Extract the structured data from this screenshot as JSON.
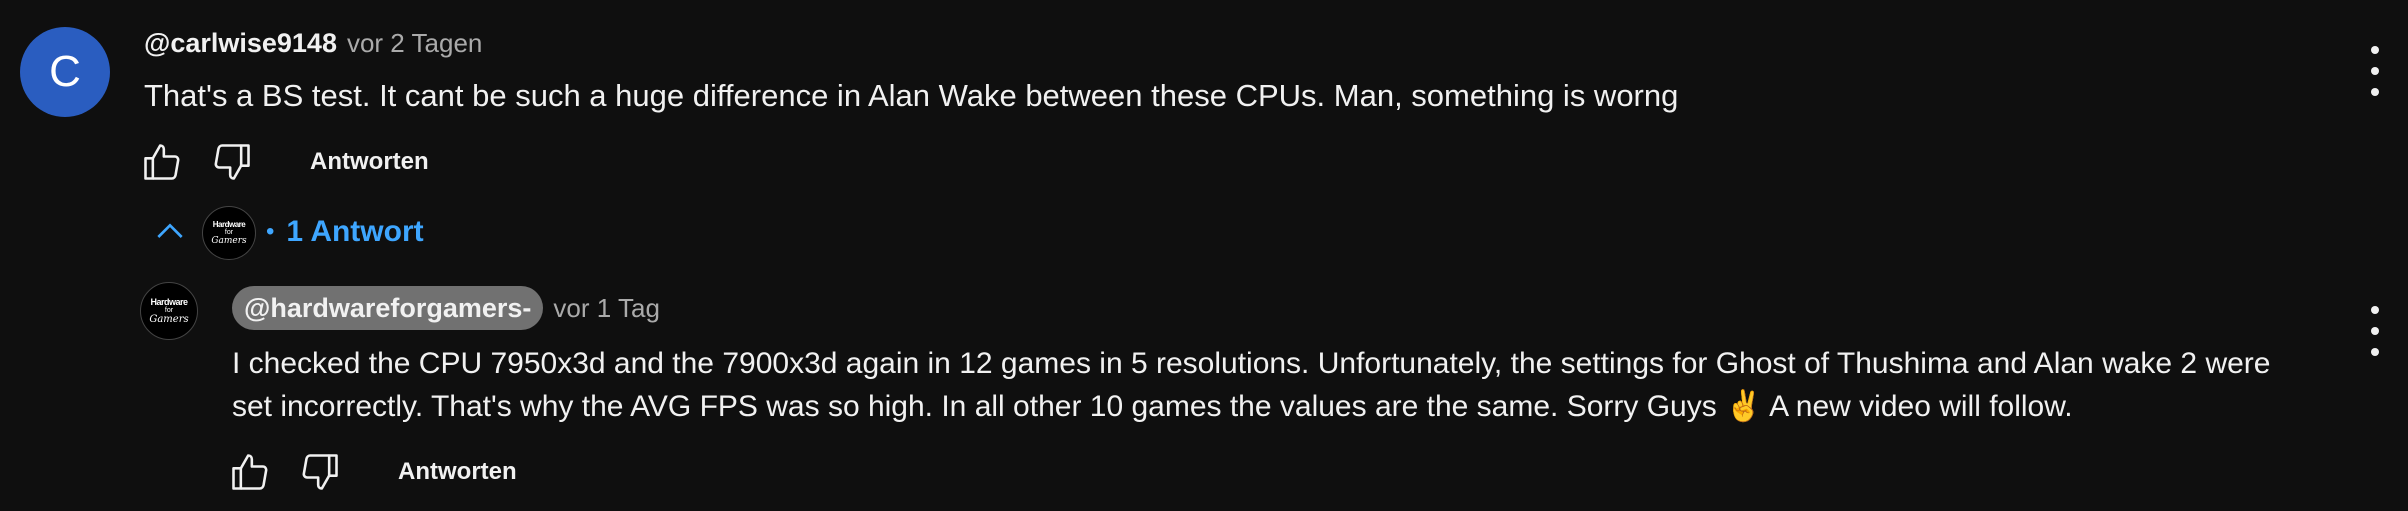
{
  "comment": {
    "avatar_letter": "C",
    "author": "@carlwise9148",
    "time": "vor 2 Tagen",
    "text": "That's a BS test. It cant be such a huge difference in Alan Wake between these CPUs. Man, something is worng",
    "reply_label": "Antworten",
    "avatar_color": "#2a5dc0"
  },
  "replies_toggle": {
    "count_label": "1 Antwort",
    "bullet": "•",
    "link_color": "#3ea6ff"
  },
  "reply": {
    "author": "@hardwareforgamers-",
    "time": "vor 1 Tag",
    "line1": "I checked the CPU 7950x3d and the 7900x3d again in 12 games in 5 resolutions. Unfortunately, the settings for Ghost of Thushima and Alan wake 2 were",
    "line2": "set incorrectly. That's why the AVG FPS was so high. In all other 10 games the values are the same. Sorry Guys ✌️  A new video will follow.",
    "reply_label": "Antworten",
    "avatar_text": {
      "l1": "Hardware",
      "l2": "for",
      "l3": "Gamers"
    }
  },
  "icons": [
    "thumbs-up-icon",
    "thumbs-down-icon",
    "chevron-up-icon",
    "more-vert-icon"
  ]
}
